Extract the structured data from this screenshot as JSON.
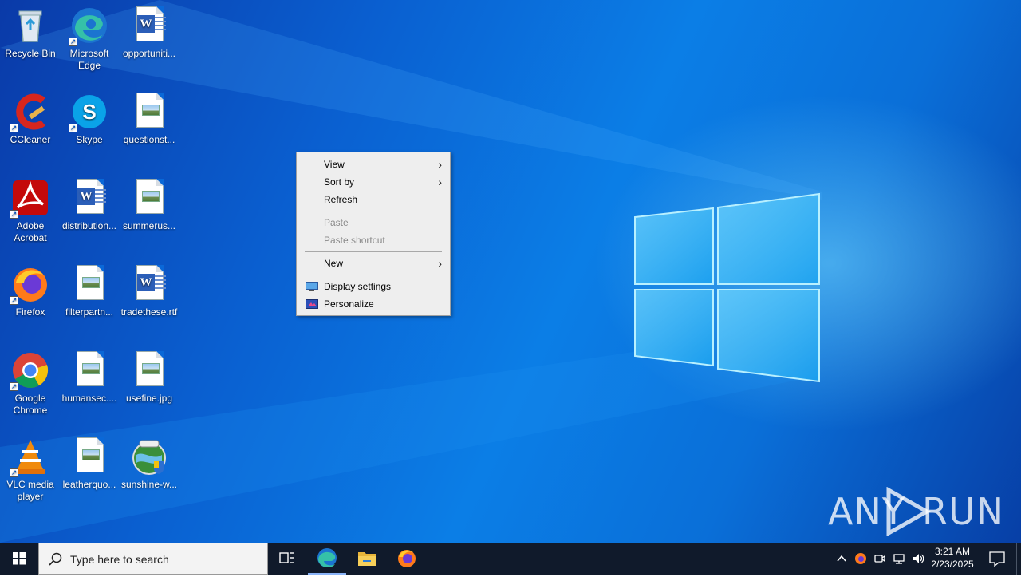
{
  "desktop": {
    "icons": [
      {
        "label": "Recycle Bin",
        "icon": "recycle-bin-icon"
      },
      {
        "label": "Microsoft Edge",
        "icon": "edge-icon"
      },
      {
        "label": "opportuniti...",
        "icon": "word-document-icon"
      },
      {
        "label": "CCleaner",
        "icon": "ccleaner-icon"
      },
      {
        "label": "Skype",
        "icon": "skype-icon"
      },
      {
        "label": "questionst...",
        "icon": "image-file-icon"
      },
      {
        "label": "Adobe Acrobat",
        "icon": "acrobat-icon"
      },
      {
        "label": "distribution...",
        "icon": "word-document-icon"
      },
      {
        "label": "summerus...",
        "icon": "image-file-icon"
      },
      {
        "label": "Firefox",
        "icon": "firefox-icon"
      },
      {
        "label": "filterpartn...",
        "icon": "image-file-icon"
      },
      {
        "label": "tradethese.rtf",
        "icon": "word-document-icon"
      },
      {
        "label": "Google Chrome",
        "icon": "chrome-icon"
      },
      {
        "label": "humansec....",
        "icon": "image-file-icon"
      },
      {
        "label": "usefine.jpg",
        "icon": "image-file-icon"
      },
      {
        "label": "VLC media player",
        "icon": "vlc-icon"
      },
      {
        "label": "leatherquo...",
        "icon": "image-file-icon"
      },
      {
        "label": "sunshine-w...",
        "icon": "installer-globe-icon"
      }
    ]
  },
  "context_menu": {
    "view": "View",
    "sort_by": "Sort by",
    "refresh": "Refresh",
    "paste": "Paste",
    "paste_shortcut": "Paste shortcut",
    "new": "New",
    "display_settings": "Display settings",
    "personalize": "Personalize"
  },
  "taskbar": {
    "search_placeholder": "Type here to search",
    "time": "3:21 AM",
    "date": "2/23/2025",
    "pinned": [
      "edge-icon",
      "file-explorer-icon",
      "firefox-icon"
    ]
  },
  "watermark": {
    "left": "ANY",
    "right": "RUN"
  },
  "colors": {
    "desktop_blue": "#0a6fd8",
    "taskbar_bg": "#101a2b",
    "menu_bg": "#eeeeee"
  }
}
